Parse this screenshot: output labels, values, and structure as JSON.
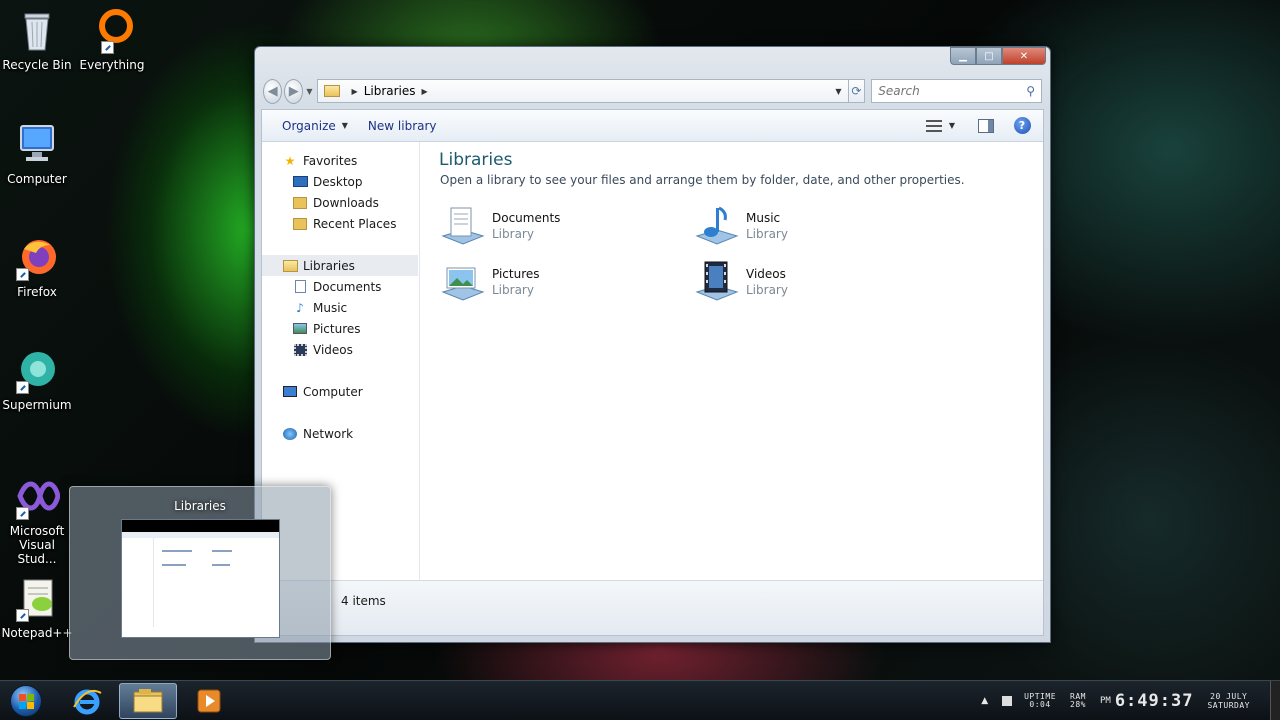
{
  "desktop": {
    "icons": [
      {
        "label": "Recycle Bin",
        "icon": "recycle-bin-icon"
      },
      {
        "label": "Everything",
        "icon": "everything-search-icon"
      },
      {
        "label": "Computer",
        "icon": "computer-icon"
      },
      {
        "label": "Firefox",
        "icon": "firefox-icon"
      },
      {
        "label": "Supermium",
        "icon": "supermium-icon"
      },
      {
        "label": "Microsoft Visual Stud...",
        "icon": "visual-studio-icon"
      },
      {
        "label": "Notepad++",
        "icon": "notepad-plus-plus-icon"
      }
    ]
  },
  "window": {
    "address": {
      "crumb": "Libraries"
    },
    "search": {
      "placeholder": "Search"
    },
    "toolbar": {
      "organize": "Organize",
      "new_library": "New library"
    },
    "nav": {
      "favorites": "Favorites",
      "desktop": "Desktop",
      "downloads": "Downloads",
      "recent_places": "Recent Places",
      "libraries": "Libraries",
      "documents": "Documents",
      "music": "Music",
      "pictures": "Pictures",
      "videos": "Videos",
      "computer": "Computer",
      "network": "Network"
    },
    "content": {
      "title": "Libraries",
      "description": "Open a library to see your files and arrange them by folder, date, and other properties.",
      "items": [
        {
          "name": "Documents",
          "type": "Library"
        },
        {
          "name": "Music",
          "type": "Library"
        },
        {
          "name": "Pictures",
          "type": "Library"
        },
        {
          "name": "Videos",
          "type": "Library"
        }
      ]
    },
    "details": {
      "count": "4 items"
    }
  },
  "thumbnail": {
    "title": "Libraries"
  },
  "tray": {
    "uptime_label": "UPTIME",
    "uptime_value": "0:04",
    "ram_label": "RAM",
    "ram_value": "28%",
    "ampm": "PM",
    "time": "6:49:37",
    "date_top": "20 JULY",
    "date_bottom": "SATURDAY"
  }
}
